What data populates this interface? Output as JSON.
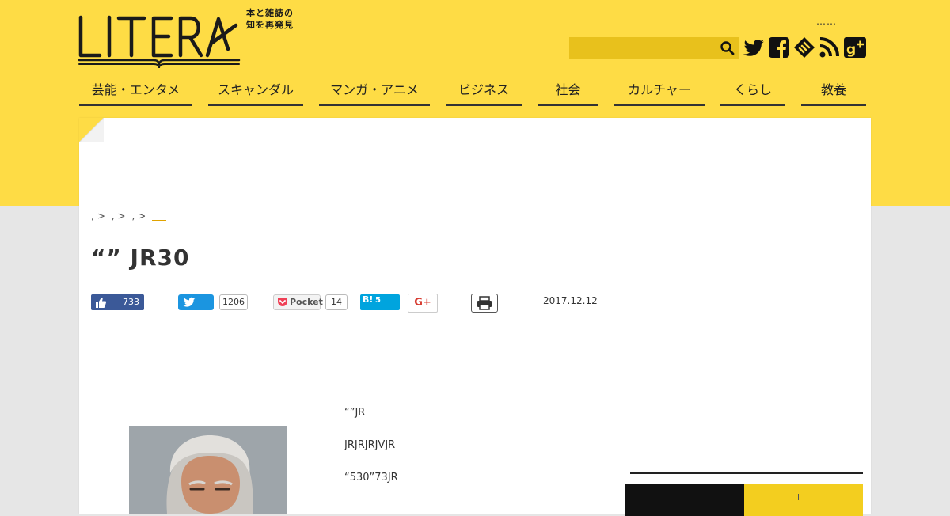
{
  "brand": {
    "logo": "LITERA",
    "tagline": "本と雑誌の知を再発見"
  },
  "header": {
    "top_links": "……",
    "search": {
      "value": "",
      "placeholder": ""
    },
    "social": [
      "twitter-icon",
      "facebook-icon",
      "feedly-icon",
      "rss-icon",
      "google-plus-icon"
    ]
  },
  "nav": {
    "items": [
      "芸能・エンタメ",
      "スキャンダル",
      "マンガ・アニメ",
      "ビジネス",
      "社会",
      "カルチャー",
      "くらし",
      "教養"
    ]
  },
  "breadcrumb": {
    "items": [
      ",",
      ",",
      ","
    ],
    "separator": ">"
  },
  "article": {
    "title": "“” JR30",
    "date": "2017.12.12",
    "share": {
      "facebook_count": "733",
      "twitter_count": "1206",
      "pocket_label": "Pocket",
      "pocket_count": "14",
      "hatena_label": "B!",
      "hatena_count": "5",
      "gplus_label": "G+"
    },
    "paragraphs": [
      "“”JR",
      "JRJRJRJVJR",
      "“530”73JR"
    ]
  },
  "colors": {
    "brand_yellow": "#fedc45",
    "facebook": "#3b5998",
    "twitter": "#1b95e0",
    "hatena": "#00a4de",
    "breadcrumb_current": "#e0a300"
  }
}
